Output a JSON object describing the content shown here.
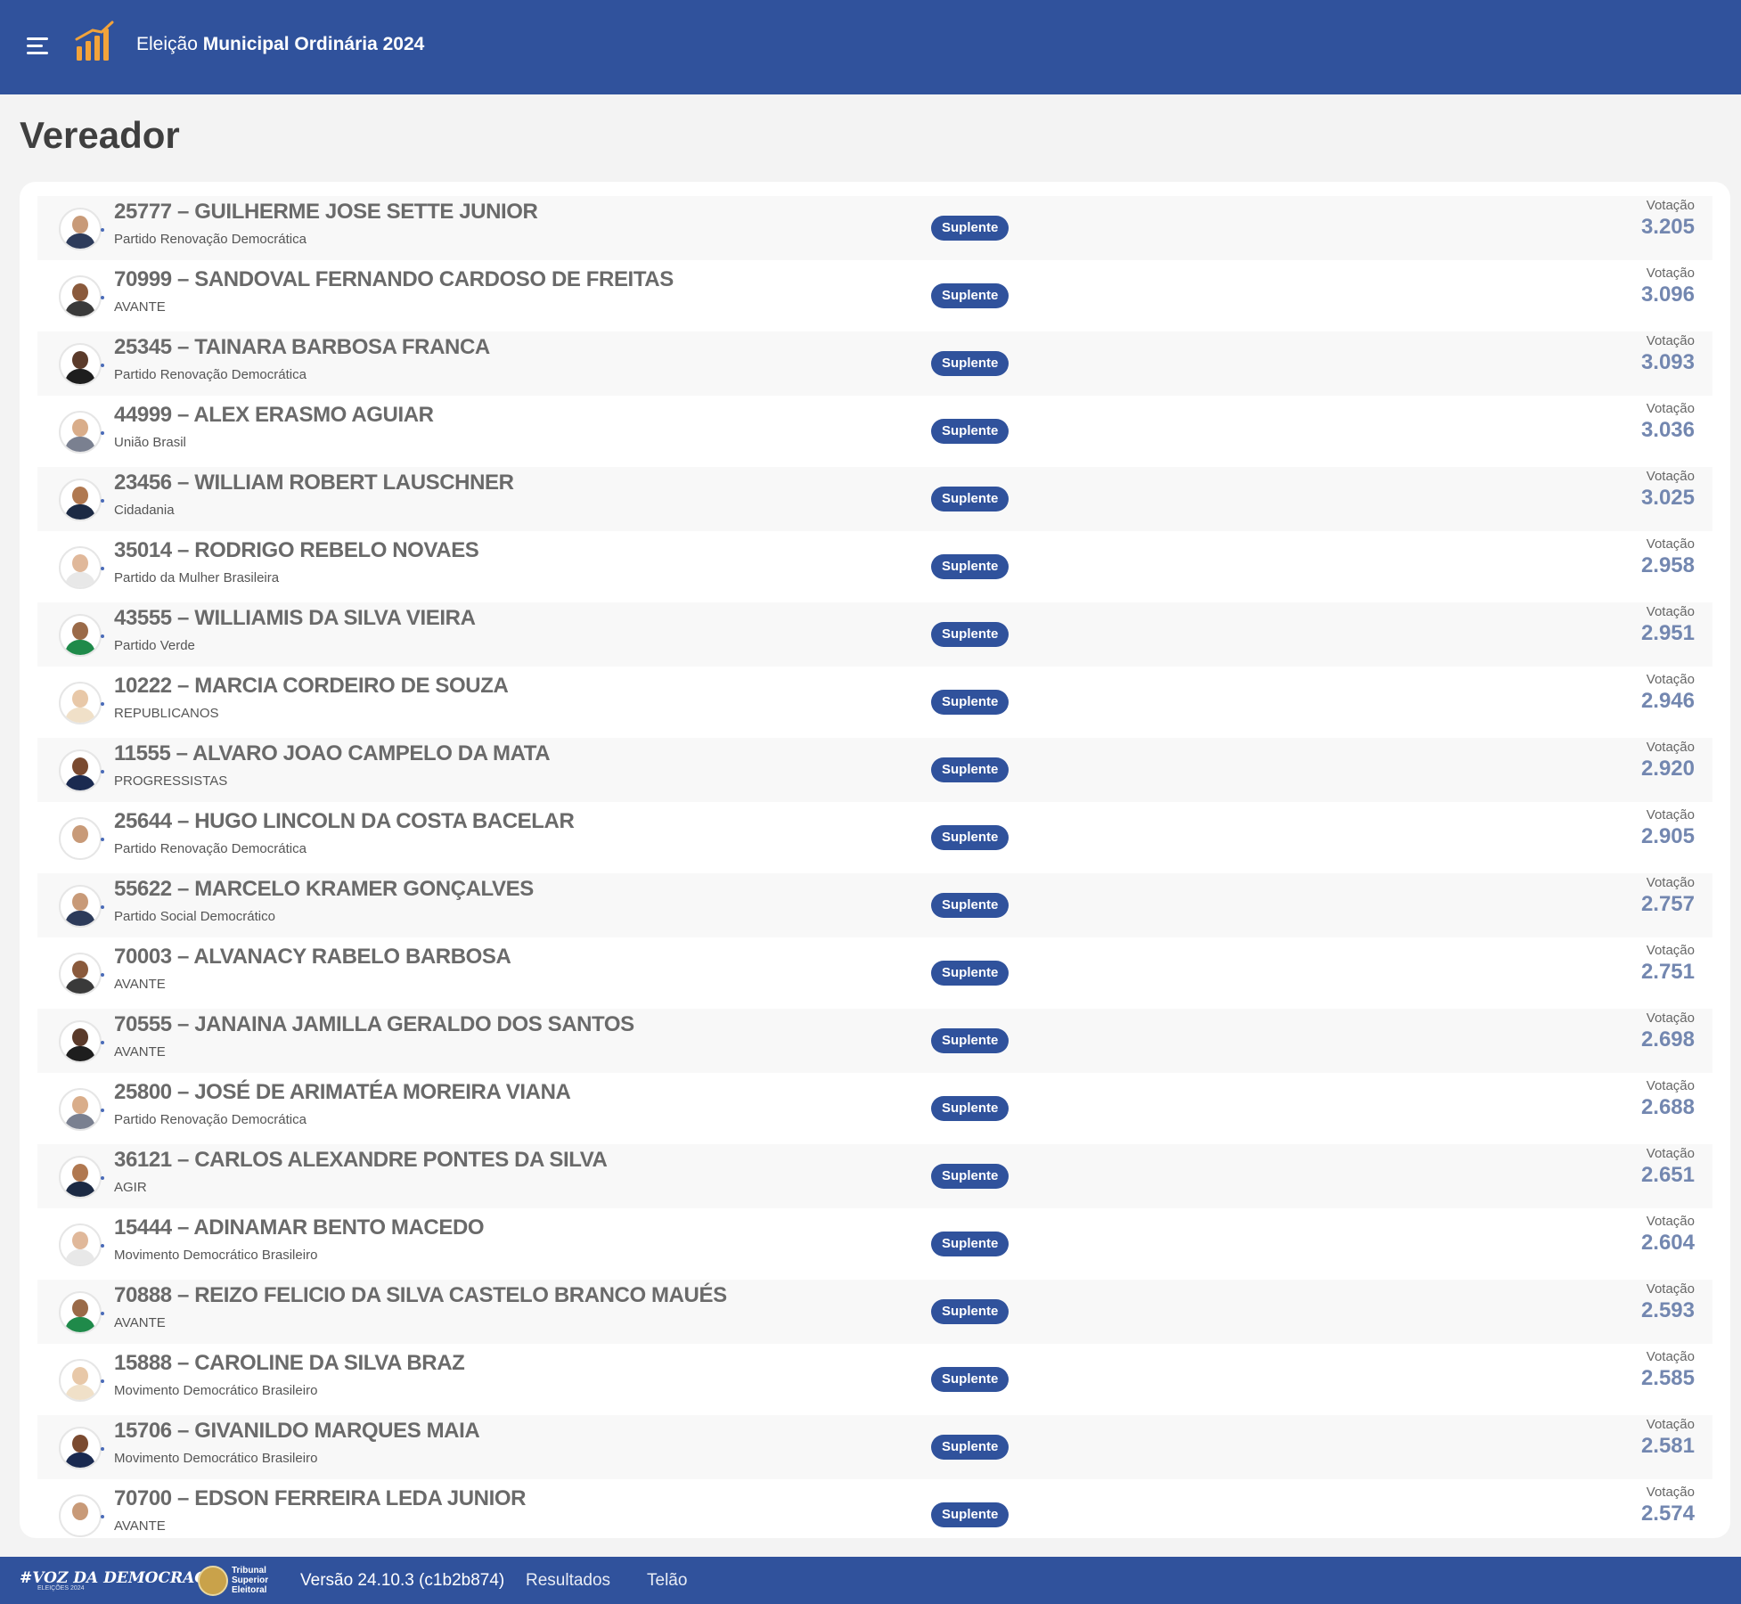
{
  "header": {
    "title_prefix": "Eleição",
    "title_strong": "Municipal Ordinária 2024"
  },
  "page_title": "Vereador",
  "badge_label": "Suplente",
  "votes_label": "Votação",
  "candidates": [
    {
      "name": "25777 – GUILHERME JOSE SETTE JUNIOR",
      "party": "Partido Renovação Democrática",
      "status": "Suplente",
      "votes": "3.205"
    },
    {
      "name": "70999 – SANDOVAL FERNANDO CARDOSO DE FREITAS",
      "party": "AVANTE",
      "status": "Suplente",
      "votes": "3.096"
    },
    {
      "name": "25345 – TAINARA BARBOSA FRANCA",
      "party": "Partido Renovação Democrática",
      "status": "Suplente",
      "votes": "3.093"
    },
    {
      "name": "44999 – ALEX ERASMO AGUIAR",
      "party": "União Brasil",
      "status": "Suplente",
      "votes": "3.036"
    },
    {
      "name": "23456 – WILLIAM ROBERT LAUSCHNER",
      "party": "Cidadania",
      "status": "Suplente",
      "votes": "3.025"
    },
    {
      "name": "35014 – RODRIGO REBELO NOVAES",
      "party": "Partido da Mulher Brasileira",
      "status": "Suplente",
      "votes": "2.958"
    },
    {
      "name": "43555 – WILLIAMIS DA SILVA VIEIRA",
      "party": "Partido Verde",
      "status": "Suplente",
      "votes": "2.951"
    },
    {
      "name": "10222 – MARCIA CORDEIRO DE SOUZA",
      "party": "REPUBLICANOS",
      "status": "Suplente",
      "votes": "2.946"
    },
    {
      "name": "11555 – ALVARO JOAO CAMPELO DA MATA",
      "party": "PROGRESSISTAS",
      "status": "Suplente",
      "votes": "2.920"
    },
    {
      "name": "25644 – HUGO LINCOLN DA COSTA BACELAR",
      "party": "Partido Renovação Democrática",
      "status": "Suplente",
      "votes": "2.905"
    },
    {
      "name": "55622 – MARCELO KRAMER GONÇALVES",
      "party": "Partido Social Democrático",
      "status": "Suplente",
      "votes": "2.757"
    },
    {
      "name": "70003 – ALVANACY RABELO BARBOSA",
      "party": "AVANTE",
      "status": "Suplente",
      "votes": "2.751"
    },
    {
      "name": "70555 – JANAINA JAMILLA GERALDO DOS SANTOS",
      "party": "AVANTE",
      "status": "Suplente",
      "votes": "2.698"
    },
    {
      "name": "25800 – JOSÉ DE ARIMATÉA MOREIRA VIANA",
      "party": "Partido Renovação Democrática",
      "status": "Suplente",
      "votes": "2.688"
    },
    {
      "name": "36121 – CARLOS ALEXANDRE PONTES DA SILVA",
      "party": "AGIR",
      "status": "Suplente",
      "votes": "2.651"
    },
    {
      "name": "15444 – ADINAMAR BENTO MACEDO",
      "party": "Movimento Democrático Brasileiro",
      "status": "Suplente",
      "votes": "2.604"
    },
    {
      "name": "70888 – REIZO FELICIO DA SILVA CASTELO BRANCO MAUÉS",
      "party": "AVANTE",
      "status": "Suplente",
      "votes": "2.593"
    },
    {
      "name": "15888 – CAROLINE DA SILVA BRAZ",
      "party": "Movimento Democrático Brasileiro",
      "status": "Suplente",
      "votes": "2.585"
    },
    {
      "name": "15706 – GIVANILDO MARQUES MAIA",
      "party": "Movimento Democrático Brasileiro",
      "status": "Suplente",
      "votes": "2.581"
    },
    {
      "name": "70700 – EDSON FERREIRA LEDA JUNIOR",
      "party": "AVANTE",
      "status": "Suplente",
      "votes": "2.574"
    }
  ],
  "footer": {
    "brand": "#VOZ DA DEMOCRACIA",
    "brand_sub": "ELEIÇÕES 2024",
    "tse": [
      "Tribunal",
      "Superior",
      "Eleitoral"
    ],
    "version": "Versão 24.10.3 (c1b2b874)",
    "links": [
      "Resultados",
      "Telão"
    ]
  },
  "colors": {
    "header_bg": "#30529c",
    "badge_bg": "#30529c",
    "votes_text": "#7387b0",
    "logo_orange": "#f2a33a"
  },
  "icons": {
    "menu": "hamburger-menu-icon",
    "logo": "bar-chart-logo-icon",
    "avatar": "candidate-photo"
  }
}
